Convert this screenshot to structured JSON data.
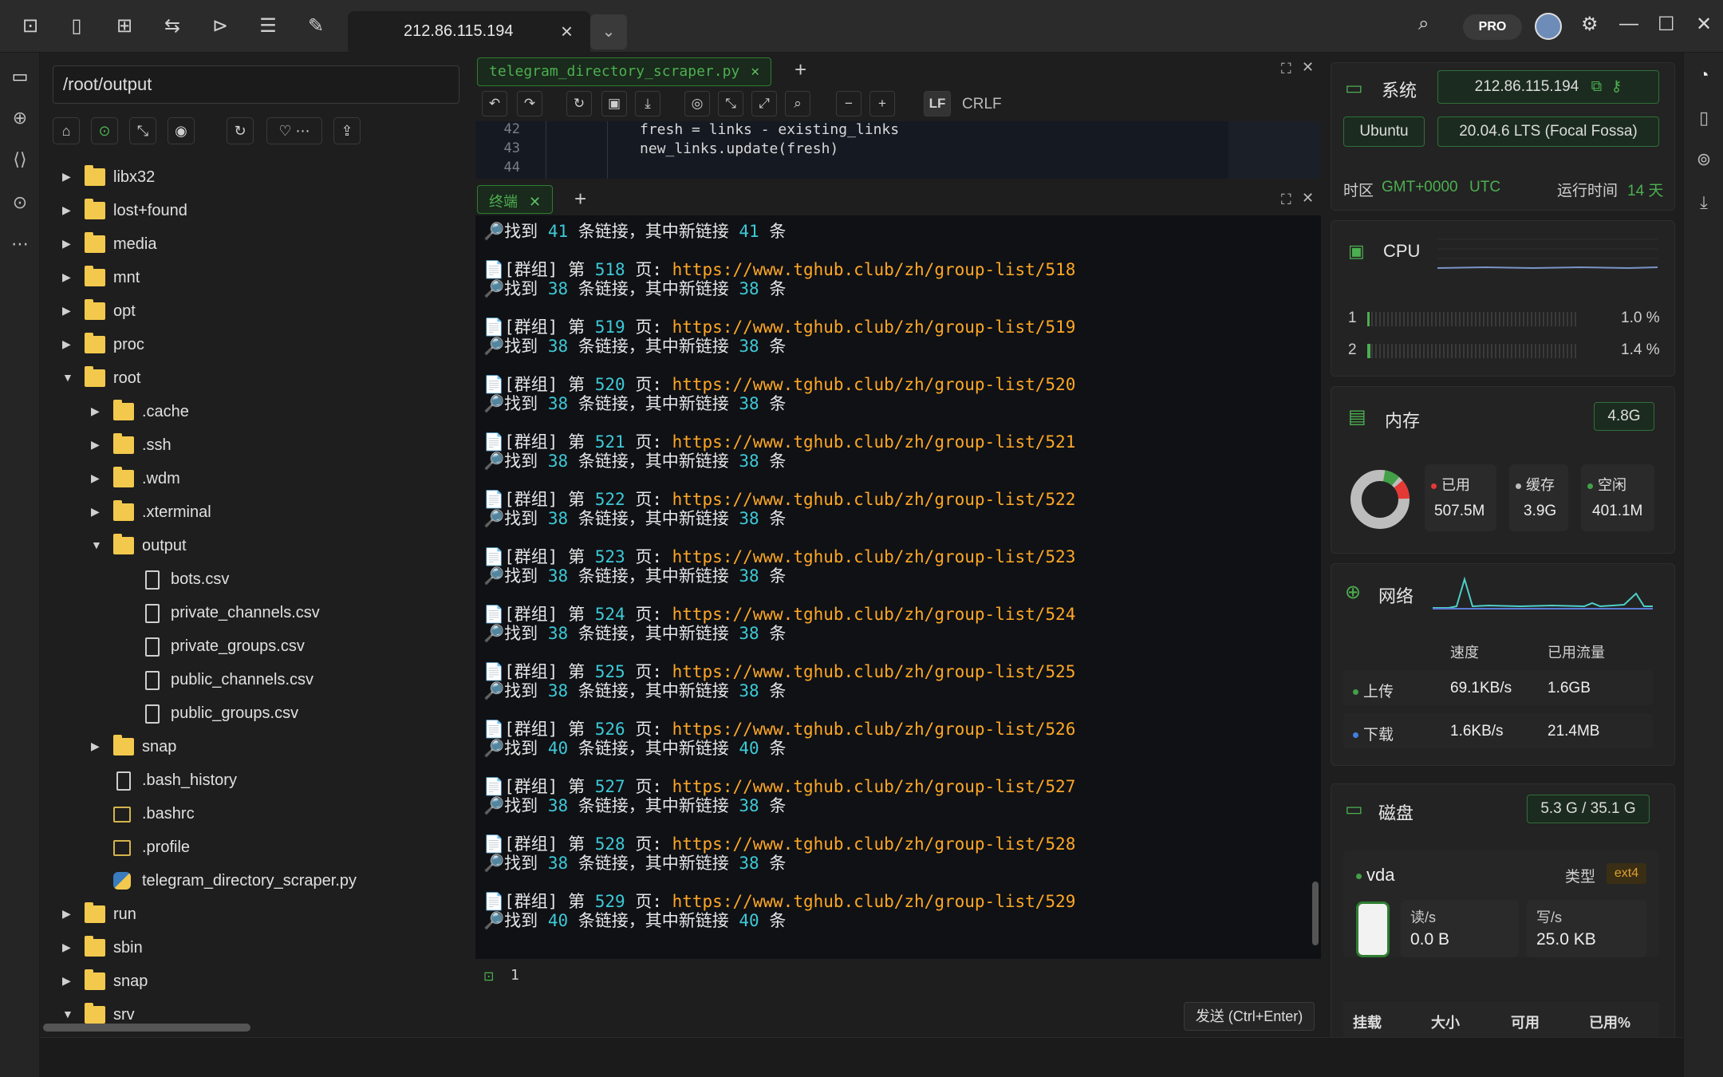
{
  "titlebar": {
    "host_tab": "212.86.115.194",
    "pro_label": "PRO"
  },
  "explorer": {
    "path": "/root/output",
    "tree": [
      {
        "label": "libx32",
        "type": "folder",
        "depth": 0,
        "expanded": false
      },
      {
        "label": "lost+found",
        "type": "folder",
        "depth": 0,
        "expanded": false
      },
      {
        "label": "media",
        "type": "folder",
        "depth": 0,
        "expanded": false
      },
      {
        "label": "mnt",
        "type": "folder",
        "depth": 0,
        "expanded": false
      },
      {
        "label": "opt",
        "type": "folder",
        "depth": 0,
        "expanded": false
      },
      {
        "label": "proc",
        "type": "folder",
        "depth": 0,
        "expanded": false
      },
      {
        "label": "root",
        "type": "folder",
        "depth": 0,
        "expanded": true
      },
      {
        "label": ".cache",
        "type": "folder",
        "depth": 1,
        "expanded": false
      },
      {
        "label": ".ssh",
        "type": "folder",
        "depth": 1,
        "expanded": false
      },
      {
        "label": ".wdm",
        "type": "folder",
        "depth": 1,
        "expanded": false
      },
      {
        "label": ".xterminal",
        "type": "folder",
        "depth": 1,
        "expanded": false
      },
      {
        "label": "output",
        "type": "folder",
        "depth": 1,
        "expanded": true
      },
      {
        "label": "bots.csv",
        "type": "file",
        "depth": 2
      },
      {
        "label": "private_channels.csv",
        "type": "file",
        "depth": 2
      },
      {
        "label": "private_groups.csv",
        "type": "file",
        "depth": 2
      },
      {
        "label": "public_channels.csv",
        "type": "file",
        "depth": 2
      },
      {
        "label": "public_groups.csv",
        "type": "file",
        "depth": 2
      },
      {
        "label": "snap",
        "type": "folder",
        "depth": 1,
        "expanded": false
      },
      {
        "label": ".bash_history",
        "type": "file",
        "depth": 1
      },
      {
        "label": ".bashrc",
        "type": "term",
        "depth": 1
      },
      {
        "label": ".profile",
        "type": "term",
        "depth": 1
      },
      {
        "label": "telegram_directory_scraper.py",
        "type": "py",
        "depth": 1
      },
      {
        "label": "run",
        "type": "folder",
        "depth": 0,
        "expanded": false
      },
      {
        "label": "sbin",
        "type": "folder",
        "depth": 0,
        "expanded": false
      },
      {
        "label": "snap",
        "type": "folder",
        "depth": 0,
        "expanded": false
      },
      {
        "label": "srv",
        "type": "folder",
        "depth": 0,
        "expanded": true
      }
    ]
  },
  "editor": {
    "tab": "telegram_directory_scraper.py",
    "lf": "LF",
    "crlf": "CRLF",
    "lines": [
      {
        "n": "42",
        "code": "fresh = links - existing_links"
      },
      {
        "n": "43",
        "code": "new_links.update(fresh)"
      },
      {
        "n": "44",
        "code": ""
      }
    ]
  },
  "terminal": {
    "tab": "终端",
    "first_found": {
      "pre": "找到 ",
      "a": "41",
      "mid": " 条链接，其中新链接 ",
      "b": "41",
      "post": " 条"
    },
    "entries": [
      {
        "page": "518",
        "url": "https://www.tghub.club/zh/group-list/518",
        "a": "38",
        "b": "38"
      },
      {
        "page": "519",
        "url": "https://www.tghub.club/zh/group-list/519",
        "a": "38",
        "b": "38"
      },
      {
        "page": "520",
        "url": "https://www.tghub.club/zh/group-list/520",
        "a": "38",
        "b": "38"
      },
      {
        "page": "521",
        "url": "https://www.tghub.club/zh/group-list/521",
        "a": "38",
        "b": "38"
      },
      {
        "page": "522",
        "url": "https://www.tghub.club/zh/group-list/522",
        "a": "38",
        "b": "38"
      },
      {
        "page": "523",
        "url": "https://www.tghub.club/zh/group-list/523",
        "a": "38",
        "b": "38"
      },
      {
        "page": "524",
        "url": "https://www.tghub.club/zh/group-list/524",
        "a": "38",
        "b": "38"
      },
      {
        "page": "525",
        "url": "https://www.tghub.club/zh/group-list/525",
        "a": "38",
        "b": "38"
      },
      {
        "page": "526",
        "url": "https://www.tghub.club/zh/group-list/526",
        "a": "40",
        "b": "40"
      },
      {
        "page": "527",
        "url": "https://www.tghub.club/zh/group-list/527",
        "a": "38",
        "b": "38"
      },
      {
        "page": "528",
        "url": "https://www.tghub.club/zh/group-list/528",
        "a": "38",
        "b": "38"
      },
      {
        "page": "529",
        "url": "https://www.tghub.club/zh/group-list/529",
        "a": "40",
        "b": "40"
      }
    ],
    "prefix": "[群组] 第 ",
    "page_suffix": " 页: ",
    "found_pre": "找到 ",
    "found_mid": " 条链接，其中新链接 ",
    "found_post": " 条",
    "input_line_no": "1",
    "send_label": "发送 (Ctrl+Enter)"
  },
  "system": {
    "title": "系统",
    "ip": "212.86.115.194",
    "os": "Ubuntu",
    "version": "20.04.6 LTS (Focal Fossa)",
    "tz_label": "时区",
    "tz_value": "GMT+0000",
    "tz_name": "UTC",
    "uptime_label": "运行时间",
    "uptime_value": "14 天"
  },
  "cpu": {
    "title": "CPU",
    "cores": [
      {
        "id": "1",
        "value": "1.0 %",
        "fraction": 0.01
      },
      {
        "id": "2",
        "value": "1.4 %",
        "fraction": 0.014
      }
    ]
  },
  "memory": {
    "title": "内存",
    "total": "4.8G",
    "used_label": "已用",
    "used": "507.5M",
    "cache_label": "缓存",
    "cache": "3.9G",
    "free_label": "空闲",
    "free": "401.1M"
  },
  "network": {
    "title": "网络",
    "col_speed": "速度",
    "col_used": "已用流量",
    "up_label": "上传",
    "up_speed": "69.1KB/s",
    "up_used": "1.6GB",
    "down_label": "下载",
    "down_speed": "1.6KB/s",
    "down_used": "21.4MB"
  },
  "disk": {
    "title": "磁盘",
    "usage": "5.3 G / 35.1 G",
    "device": "vda",
    "type_label": "类型",
    "fs": "ext4",
    "read_label": "读/s",
    "read": "0.0 B",
    "write_label": "写/s",
    "write": "25.0 KB",
    "cols": [
      "挂载",
      "大小",
      "可用",
      "已用%"
    ]
  },
  "colors": {
    "accent": "#4caf50",
    "url": "#ffa726",
    "number": "#3ec9d6"
  }
}
